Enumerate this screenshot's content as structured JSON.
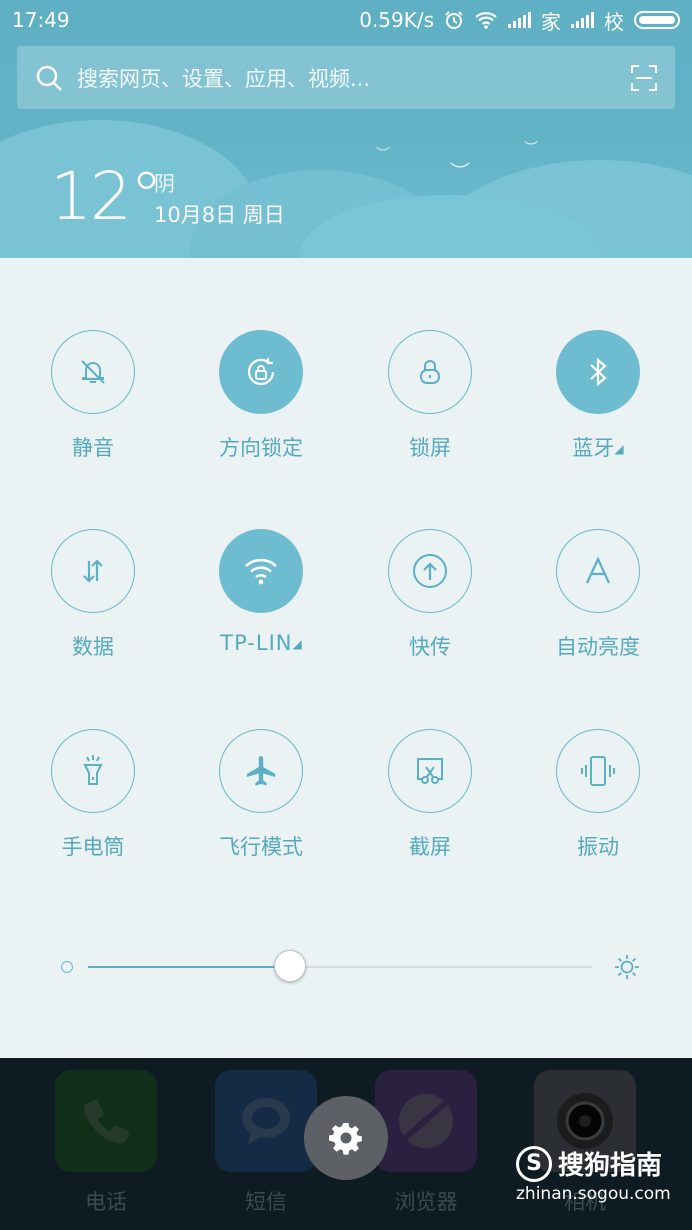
{
  "status_bar": {
    "time": "17:49",
    "net_speed": "0.59K/s",
    "carrier1": "家",
    "carrier2": "校"
  },
  "search": {
    "placeholder": "搜索网页、设置、应用、视频..."
  },
  "weather": {
    "temp": "12°",
    "condition": "阴",
    "date": "10月8日 周日"
  },
  "tiles": [
    {
      "label": "静音",
      "icon": "bell-off-icon",
      "on": false
    },
    {
      "label": "方向锁定",
      "icon": "rotation-lock-icon",
      "on": true
    },
    {
      "label": "锁屏",
      "icon": "lock-icon",
      "on": false
    },
    {
      "label": "蓝牙",
      "icon": "bluetooth-icon",
      "on": true,
      "expand": "◢"
    },
    {
      "label": "数据",
      "icon": "data-arrows-icon",
      "on": false
    },
    {
      "label": "TP-LIN",
      "icon": "wifi-icon",
      "on": true,
      "expand": "◢"
    },
    {
      "label": "快传",
      "icon": "upload-icon",
      "on": false
    },
    {
      "label": "自动亮度",
      "icon": "auto-brightness-icon",
      "on": false
    },
    {
      "label": "手电筒",
      "icon": "flashlight-icon",
      "on": false
    },
    {
      "label": "飞行模式",
      "icon": "airplane-icon",
      "on": false
    },
    {
      "label": "截屏",
      "icon": "screenshot-icon",
      "on": false
    },
    {
      "label": "振动",
      "icon": "vibrate-icon",
      "on": false
    }
  ],
  "brightness": {
    "level": 0.4
  },
  "dock": [
    {
      "label": "电话",
      "icon": "phone-icon",
      "color": "#123019"
    },
    {
      "label": "短信",
      "icon": "message-icon",
      "color": "#152a45"
    },
    {
      "label": "浏览器",
      "icon": "browser-icon",
      "color": "#2a2040"
    },
    {
      "label": "相机",
      "icon": "camera-icon",
      "color": "#2b2f33"
    }
  ],
  "watermark": {
    "brand": "搜狗指南",
    "url": "zhinan.sogou.com"
  },
  "colors": {
    "accent": "#5bb0c4",
    "panel": "#eaf2f4",
    "header": "#63b3c7"
  }
}
